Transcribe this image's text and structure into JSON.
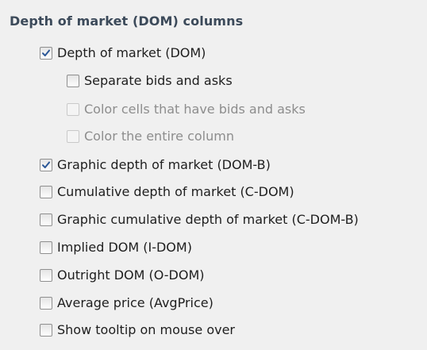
{
  "section": {
    "title": "Depth of market (DOM) columns"
  },
  "options": [
    {
      "label": "Depth of market (DOM)",
      "checked": true,
      "enabled": true,
      "level": 1
    },
    {
      "label": "Separate bids and asks",
      "checked": false,
      "enabled": true,
      "level": 2
    },
    {
      "label": "Color cells that have bids and asks",
      "checked": false,
      "enabled": false,
      "level": 2
    },
    {
      "label": "Color the entire column",
      "checked": false,
      "enabled": false,
      "level": 2
    },
    {
      "label": "Graphic depth of market (DOM-B)",
      "checked": true,
      "enabled": true,
      "level": 1
    },
    {
      "label": "Cumulative depth of market (C-DOM)",
      "checked": false,
      "enabled": true,
      "level": 1
    },
    {
      "label": "Graphic cumulative depth of market (C-DOM-B)",
      "checked": false,
      "enabled": true,
      "level": 1
    },
    {
      "label": "Implied DOM (I-DOM)",
      "checked": false,
      "enabled": true,
      "level": 1
    },
    {
      "label": "Outright DOM (O-DOM)",
      "checked": false,
      "enabled": true,
      "level": 1
    },
    {
      "label": "Average price (AvgPrice)",
      "checked": false,
      "enabled": true,
      "level": 1
    },
    {
      "label": "Show tooltip on mouse over",
      "checked": false,
      "enabled": true,
      "level": 1
    }
  ],
  "colors": {
    "title": "#3c4a5a",
    "check_mark": "#2b5797",
    "disabled_text": "#8d8d8d"
  },
  "icons": {
    "check": "checkmark-icon"
  }
}
